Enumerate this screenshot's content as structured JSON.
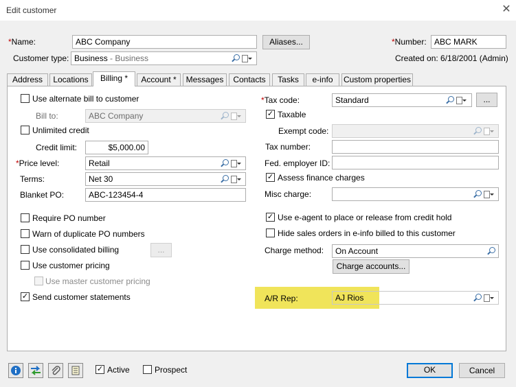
{
  "window": {
    "title": "Edit customer",
    "close_glyph": "✕"
  },
  "header": {
    "name_label": "Name:",
    "name_value": "ABC Company",
    "aliases_button": "Aliases...",
    "number_label": "Number:",
    "number_value": "ABC MARK",
    "customer_type_label": "Customer type:",
    "customer_type_value": "Business",
    "customer_type_sub": " - Business",
    "created_on": "Created on: 6/18/2001 (Admin)",
    "required_mark": "*"
  },
  "tabs": [
    {
      "label": "Address"
    },
    {
      "label": "Locations"
    },
    {
      "label": "Billing *",
      "active": true
    },
    {
      "label": "Account *"
    },
    {
      "label": "Messages"
    },
    {
      "label": "Contacts"
    },
    {
      "label": "Tasks"
    },
    {
      "label": "e-info"
    },
    {
      "label": "Custom properties"
    }
  ],
  "billing": {
    "use_alternate_bill": {
      "label": "Use alternate bill to customer",
      "checked": false
    },
    "bill_to_label": "Bill to:",
    "bill_to_value": "ABC Company",
    "unlimited_credit": {
      "label": "Unlimited credit",
      "checked": false
    },
    "credit_limit_label": "Credit limit:",
    "credit_limit_value": "$5,000.00",
    "price_level_label": "Price level:",
    "price_level_value": "Retail",
    "terms_label": "Terms:",
    "terms_value": "Net 30",
    "blanket_po_label": "Blanket PO:",
    "blanket_po_value": "ABC-123454-4",
    "require_po": {
      "label": "Require PO number",
      "checked": false
    },
    "warn_duplicate_po": {
      "label": "Warn of duplicate PO numbers",
      "checked": false
    },
    "consolidated_billing": {
      "label": "Use consolidated billing",
      "checked": false
    },
    "consolidated_button": "...",
    "customer_pricing": {
      "label": "Use customer pricing",
      "checked": false
    },
    "master_pricing": {
      "label": "Use master customer pricing",
      "checked": false
    },
    "send_statements": {
      "label": "Send customer statements",
      "checked": true
    },
    "tax_code_label": "Tax code:",
    "tax_code_value": "Standard",
    "tax_code_button": "...",
    "taxable": {
      "label": "Taxable",
      "checked": true
    },
    "exempt_code_label": "Exempt code:",
    "tax_number_label": "Tax number:",
    "fed_employer_label": "Fed. employer ID:",
    "assess_finance": {
      "label": "Assess finance charges",
      "checked": true
    },
    "misc_charge_label": "Misc charge:",
    "use_eagent": {
      "label": "Use e-agent to place or release from credit hold",
      "checked": true
    },
    "hide_sales_orders": {
      "label": "Hide sales orders in e-info billed to this customer",
      "checked": false
    },
    "charge_method_label": "Charge method:",
    "charge_method_value": "On Account",
    "charge_accounts_button": "Charge accounts...",
    "ar_rep_label": "A/R Rep:",
    "ar_rep_value": "AJ Rios",
    "check_glyph": "✓"
  },
  "footer": {
    "active": {
      "label": "Active",
      "checked": true
    },
    "prospect": {
      "label": "Prospect",
      "checked": false
    },
    "ok_button": "OK",
    "cancel_button": "Cancel",
    "icons": [
      "info-icon",
      "transfer-arrows-icon",
      "paperclip-icon",
      "notes-icon"
    ]
  },
  "colors": {
    "highlight": "#f0e45a",
    "required": "#c00000",
    "accent": "#0078d7"
  }
}
